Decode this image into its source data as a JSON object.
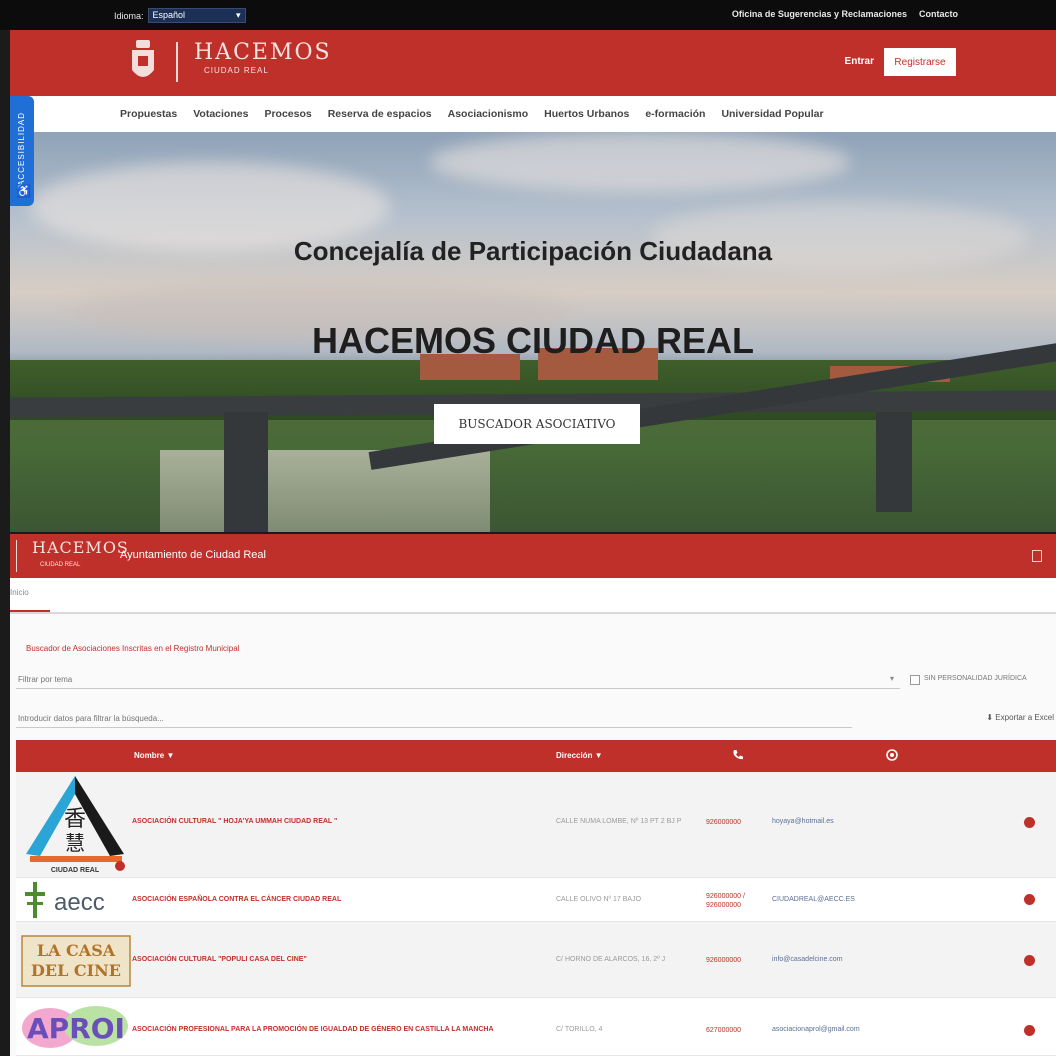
{
  "topbar": {
    "language_label": "Idioma:",
    "language_value": "Español",
    "links": [
      "Oficina de Sugerencias y Reclamaciones",
      "Contacto"
    ]
  },
  "header": {
    "logo_title": "HACEMOS",
    "logo_sub": "CIUDAD REAL",
    "login": "Entrar",
    "register": "Registrarse"
  },
  "nav": {
    "items": [
      "Propuestas",
      "Votaciones",
      "Procesos",
      "Reserva de espacios",
      "Asociacionismo",
      "Huertos Urbanos",
      "e-formación",
      "Universidad Popular"
    ]
  },
  "accessibility": {
    "label": "ACCESIBILIDAD"
  },
  "hero": {
    "subtitle": "Concejalía de Participación Ciudadana",
    "title": "HACEMOS CIUDAD REAL",
    "button": "BUSCADOR ASOCIATIVO"
  },
  "app": {
    "logo_title": "HACEMOS",
    "logo_sub": "CIUDAD REAL",
    "title": "Ayuntamiento de Ciudad Real",
    "tab": "Inicio",
    "section_title": "Buscador de Asociaciones Inscritas en el Registro Municipal",
    "filter_placeholder": "Filtrar por tema",
    "checkbox_label": "SIN PERSONALIDAD JURÍDICA",
    "search_placeholder": "Introducir datos para filtrar la búsqueda...",
    "export_label": "Exportar a Excel",
    "columns": {
      "name": "Nombre ▼",
      "address": "Dirección ▼"
    },
    "rows": [
      {
        "name": "ASOCIACIÓN CULTURAL \" HOJA'YA UMMAH CIUDAD REAL \"",
        "address": "CALLE NUMA LOMBE, Nº 13 PT 2 BJ P",
        "phone": "926000000",
        "email": "hoyaya@hotmail.es"
      },
      {
        "name": "ASOCIACIÓN ESPAÑOLA CONTRA EL CÁNCER CIUDAD REAL",
        "address": "CALLE OLIVO Nº 17 BAJO",
        "phone": "926000000 / 926000000",
        "email": "CIUDADREAL@AECC.ES"
      },
      {
        "name": "ASOCIACIÓN CULTURAL \"POPULI CASA DEL CINE\"",
        "address": "C/ HORNO DE ALARCOS, 16, 2º J",
        "phone": "926000000",
        "email": "info@casadelcine.com"
      },
      {
        "name": "ASOCIACIÓN PROFESIONAL PARA LA PROMOCIÓN DE IGUALDAD DE GÉNERO EN CASTILLA LA MANCHA",
        "address": "C/ TORILLO, 4",
        "phone": "627000000",
        "email": "asociacionaprol@gmail.com"
      }
    ],
    "logos": [
      "HOJA'YA UMMAH",
      "aecc",
      "LA CASA DEL CINE",
      "APROI"
    ]
  },
  "colors": {
    "brand_red": "#c0302a",
    "white": "#ffffff",
    "topbar": "#0c0c0c",
    "a11y_blue": "#1f6fd6"
  }
}
